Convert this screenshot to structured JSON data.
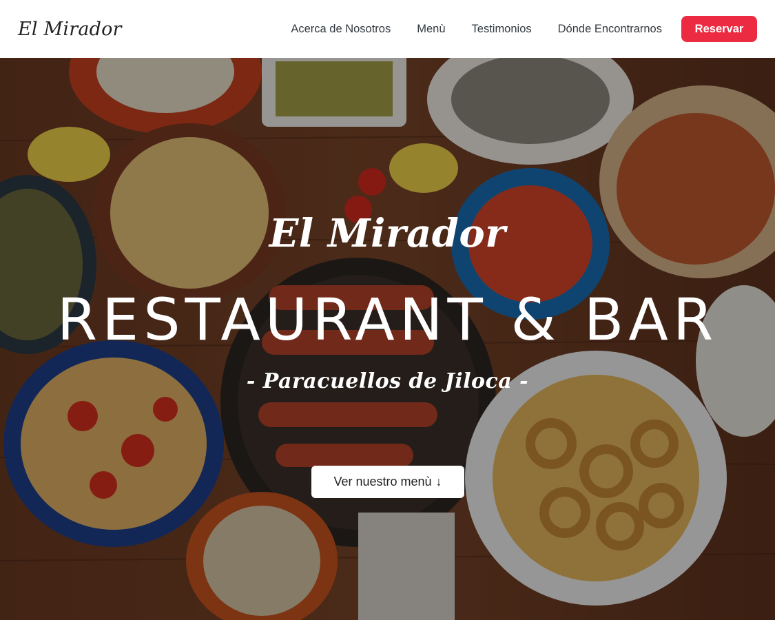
{
  "navbar": {
    "brand": "El Mirador",
    "links": [
      "Acerca de Nosotros",
      "Menù",
      "Testimonios",
      "Dónde Encontrarnos"
    ],
    "reserve_label": "Reservar"
  },
  "hero": {
    "script_name": "El Mirador",
    "title": "RESTAURANT & BAR",
    "subtitle": "- Paracuellos de Jiloca -",
    "cta_label": "Ver nuestro menù",
    "cta_icon": "arrow-down-icon"
  },
  "colors": {
    "accent": "#ec2b42",
    "nav_text": "#333a40",
    "hero_text": "#ffffff"
  }
}
